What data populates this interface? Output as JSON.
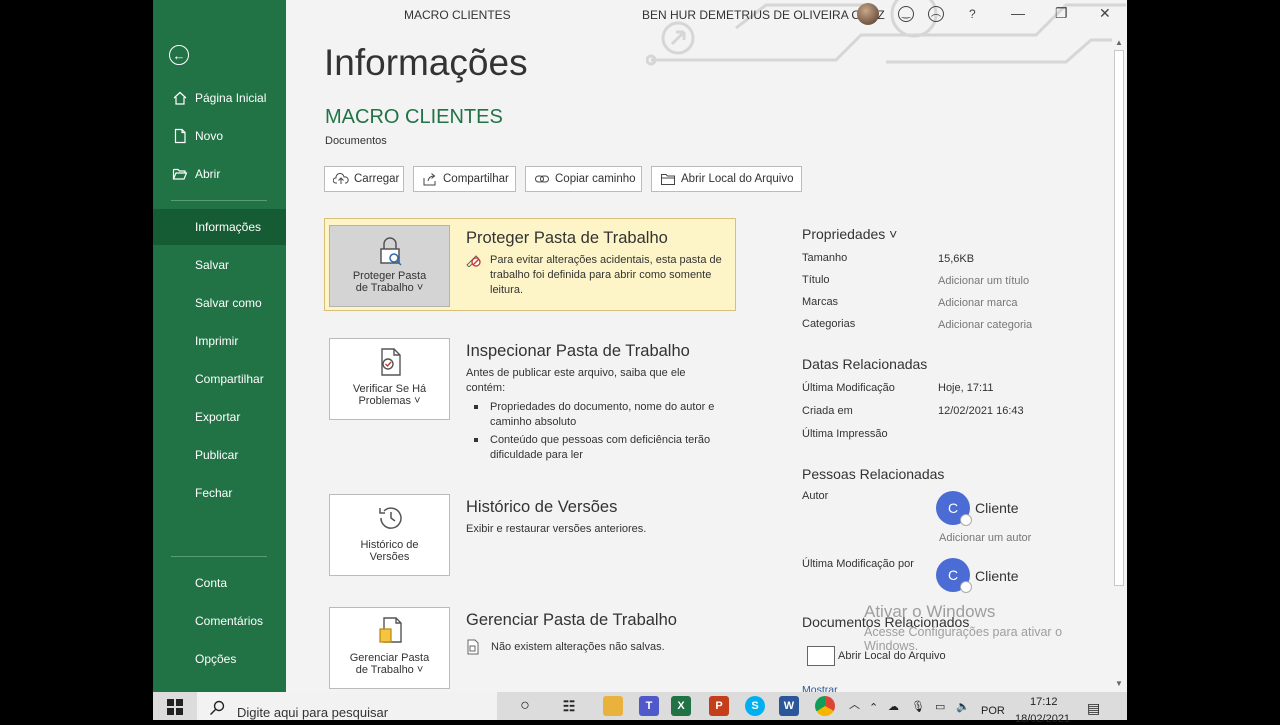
{
  "window": {
    "doc_title": "MACRO CLIENTES",
    "user_name": "BEN HUR DEMETRIUS DE OLIVEIRA CRUZ",
    "help": "?",
    "minimize": "—",
    "restore": "❐",
    "close": "✕"
  },
  "sidebar": {
    "back_icon": "←",
    "top_items": [
      {
        "label": "Página Inicial",
        "icon": "home-icon"
      },
      {
        "label": "Novo",
        "icon": "new-document-icon"
      },
      {
        "label": "Abrir",
        "icon": "open-folder-icon"
      }
    ],
    "items": [
      {
        "label": "Informações",
        "active": true
      },
      {
        "label": "Salvar"
      },
      {
        "label": "Salvar como"
      },
      {
        "label": "Imprimir"
      },
      {
        "label": "Compartilhar"
      },
      {
        "label": "Exportar"
      },
      {
        "label": "Publicar"
      },
      {
        "label": "Fechar"
      }
    ],
    "bottom_items": [
      {
        "label": "Conta"
      },
      {
        "label": "Comentários"
      },
      {
        "label": "Opções"
      }
    ]
  },
  "main": {
    "title": "Informações",
    "file_name": "MACRO CLIENTES",
    "file_location": "Documentos",
    "actions": [
      {
        "label": "Carregar",
        "icon": "upload-icon"
      },
      {
        "label": "Compartilhar",
        "icon": "share-icon"
      },
      {
        "label": "Copiar caminho",
        "icon": "link-icon"
      },
      {
        "label": "Abrir Local do Arquivo",
        "icon": "folder-icon"
      }
    ],
    "protect": {
      "button_line1": "Proteger Pasta",
      "button_line2": "de Trabalho ˅",
      "title": "Proteger Pasta de Trabalho",
      "text": "Para evitar alterações acidentais, esta pasta de trabalho foi definida para abrir como somente leitura."
    },
    "inspect": {
      "button_line1": "Verificar Se Há",
      "button_line2": "Problemas ˅",
      "title": "Inspecionar Pasta de Trabalho",
      "text": "Antes de publicar este arquivo, saiba que ele contém:",
      "bullets": [
        "Propriedades do documento, nome do autor e caminho absoluto",
        "Conteúdo que pessoas com deficiência terão dificuldade para ler"
      ]
    },
    "history": {
      "button_line1": "Histórico de",
      "button_line2": "Versões",
      "title": "Histórico de Versões",
      "text": "Exibir e restaurar versões anteriores."
    },
    "manage": {
      "button_line1": "Gerenciar Pasta",
      "button_line2": "de Trabalho ˅",
      "title": "Gerenciar Pasta de Trabalho",
      "text": "Não existem alterações não salvas."
    }
  },
  "properties": {
    "heading": "Propriedades ˅",
    "rows": [
      {
        "key": "Tamanho",
        "value": "15,6KB"
      },
      {
        "key": "Título",
        "value": "Adicionar um título"
      },
      {
        "key": "Marcas",
        "value": "Adicionar marca"
      },
      {
        "key": "Categorias",
        "value": "Adicionar categoria"
      }
    ],
    "dates_heading": "Datas Relacionadas",
    "dates": [
      {
        "key": "Última Modificação",
        "value": "Hoje, 17:11"
      },
      {
        "key": "Criada em",
        "value": "12/02/2021 16:43"
      },
      {
        "key": "Última Impressão",
        "value": ""
      }
    ],
    "people_heading": "Pessoas Relacionadas",
    "author_label": "Autor",
    "author_initial": "C",
    "author_name": "Cliente",
    "add_author": "Adicionar um autor",
    "modified_by_label": "Última Modificação por",
    "modified_by_initial": "C",
    "modified_by_name": "Cliente",
    "docs_heading": "Documentos Relacionados",
    "open_location": "Abrir Local do Arquivo",
    "show_all": "Mostrar Todas as Propriedades"
  },
  "watermark": {
    "line1": "Ativar o Windows",
    "line2": "Acesse Configurações para ativar o",
    "line3": "Windows."
  },
  "taskbar": {
    "search_placeholder": "Digite aqui para pesquisar",
    "language": "POR",
    "time": "17:12",
    "date": "18/02/2021"
  }
}
